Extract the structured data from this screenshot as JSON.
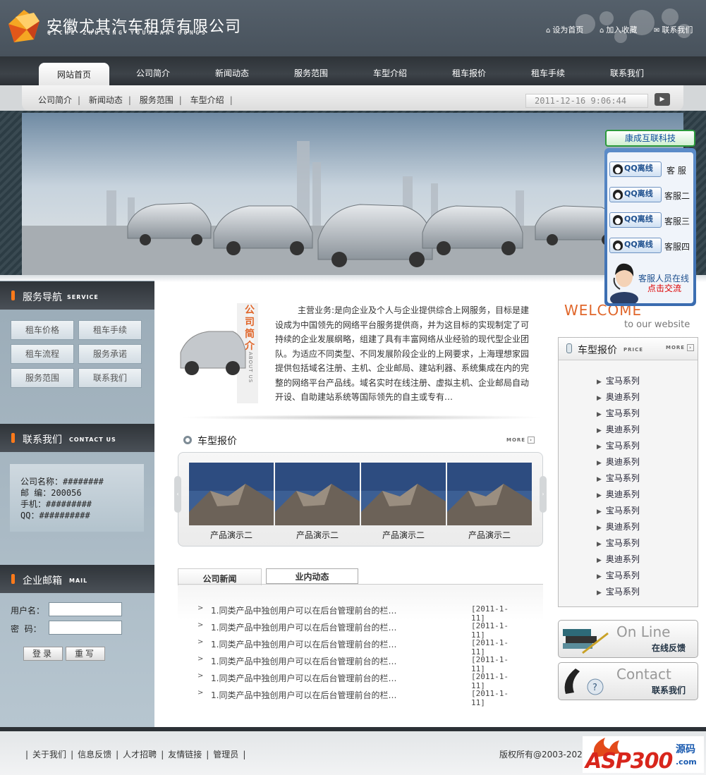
{
  "site": {
    "company_name": "安徽尤其汽车租赁有限公司",
    "company_pinyin": "QICHE ZHULING YOUXIAN GONGS"
  },
  "top_links": [
    {
      "label": "设为首页",
      "icon": "home-icon"
    },
    {
      "label": "加入收藏",
      "icon": "favorite-icon"
    },
    {
      "label": "联系我们",
      "icon": "mail-icon"
    }
  ],
  "nav": [
    {
      "label": "网站首页",
      "active": true
    },
    {
      "label": "公司简介"
    },
    {
      "label": "新闻动态"
    },
    {
      "label": "服务范围"
    },
    {
      "label": "车型介绍"
    },
    {
      "label": "租车报价"
    },
    {
      "label": "租车手续"
    },
    {
      "label": "联系我们"
    }
  ],
  "subnav": [
    "公司简介",
    "新闻动态",
    "服务范围",
    "车型介绍"
  ],
  "datetime": "2011-12-16 9:06:44",
  "sidebar": {
    "service_title": "服务导航",
    "service_en": "SERVICE",
    "service_buttons": [
      "租车价格",
      "租车手续",
      "租车流程",
      "服务承诺",
      "服务范围",
      "联系我们"
    ],
    "contact_title": "联系我们",
    "contact_en": "CONTACT US",
    "contact_lines": [
      "公司名称：########",
      "邮 编：200056",
      "手机：#########",
      "QQ：##########"
    ],
    "mail_title": "企业邮箱",
    "mail_en": "MAIL",
    "username_label": "用户名：",
    "password_label": "密  码：",
    "login_button": "登录",
    "reset_button": "重写"
  },
  "intro": {
    "title_chars": [
      "公",
      "司",
      "简",
      "介"
    ],
    "title_en": "ABOUT US",
    "text": "主营业务:是向企业及个人与企业提供综合上网服务，目标是建设成为中国领先的网络平台服务提供商，并为这目标的实现制定了可持续的企业发展纲略，组建了具有丰富网络从业经验的现代型企业团队。为适应不同类型、不同发展阶段企业的上网要求，上海理想家园提供包括域名注册、主机、企业邮局、建站利器、系统集成在内的完整的网络平台产品线。域名实时在线注册、虚拟主机、企业邮局自动开设、自助建站系统等国际领先的自主或专有…"
  },
  "car_section": {
    "title": "车型报价",
    "more": "MORE",
    "products": [
      "产品演示二",
      "产品演示二",
      "产品演示二",
      "产品演示二"
    ]
  },
  "news": {
    "tabs": [
      "公司新闻",
      "业内动态"
    ],
    "items": [
      {
        "title": "1.同类产品中独创用户可以在后台管理前台的栏…",
        "date": "[2011-1-11]"
      },
      {
        "title": "1.同类产品中独创用户可以在后台管理前台的栏…",
        "date": "[2011-1-11]"
      },
      {
        "title": "1.同类产品中独创用户可以在后台管理前台的栏…",
        "date": "[2011-1-11]"
      },
      {
        "title": "1.同类产品中独创用户可以在后台管理前台的栏…",
        "date": "[2011-1-11]"
      },
      {
        "title": "1.同类产品中独创用户可以在后台管理前台的栏…",
        "date": "[2011-1-11]"
      },
      {
        "title": "1.同类产品中独创用户可以在后台管理前台的栏…",
        "date": "[2011-1-11]"
      }
    ]
  },
  "right": {
    "welcome": "WELCOME",
    "to_website": "to our website",
    "price_title": "车型报价",
    "price_en": "PRICE",
    "more": "MORE",
    "price_items": [
      "宝马系列",
      "奥迪系列",
      "宝马系列",
      "奥迪系列",
      "宝马系列",
      "奥迪系列",
      "宝马系列",
      "奥迪系列",
      "宝马系列",
      "奥迪系列",
      "宝马系列",
      "奥迪系列",
      "宝马系列",
      "宝马系列"
    ],
    "online_big": "On Line",
    "online_small": "在线反馈",
    "contact_big": "Contact",
    "contact_small": "联系我们"
  },
  "qq_panel": {
    "title": "康成互联科技",
    "button_label": "QQ离线",
    "agents": [
      "客 服",
      "客服二",
      "客服三",
      "客服四"
    ],
    "online_text": "客服人员在线",
    "talk_text": "点击交流"
  },
  "footer": {
    "links": [
      "关于我们",
      "信息反馈",
      "人才招聘",
      "友情链接",
      "管理员"
    ],
    "copyright": "版权所有@2003-202",
    "badge_text": "ASP300",
    "badge_sub": "源码",
    "badge_domain": ".com"
  },
  "colors": {
    "accent_orange": "#e0662a",
    "header_bg": "#4f5a64",
    "sidebar_bg": "#aebdc8"
  }
}
